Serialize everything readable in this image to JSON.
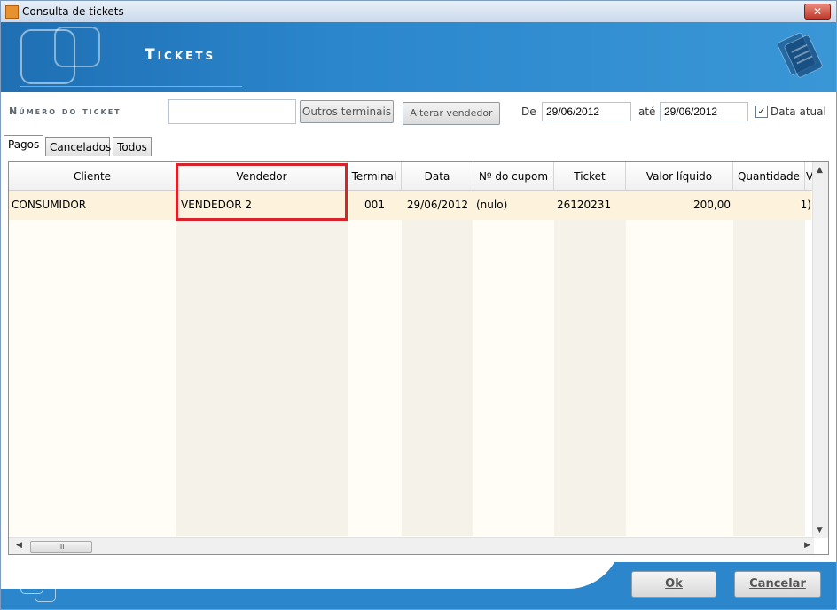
{
  "window": {
    "title": "Consulta de tickets",
    "close_label": "✕"
  },
  "header": {
    "title": "Tickets"
  },
  "filters": {
    "ticket_label": "Número do ticket",
    "ticket_value": "",
    "other_terminals_label": "Outros terminais",
    "change_seller_label": "Alterar vendedor",
    "from_label": "De",
    "from_value": "29/06/2012",
    "to_label": "até",
    "to_value": "29/06/2012",
    "current_date_label": "Data atual",
    "current_date_checked": true
  },
  "tabs": [
    {
      "label": "Pagos",
      "active": true
    },
    {
      "label": "Cancelados",
      "active": false
    },
    {
      "label": "Todos",
      "active": false
    }
  ],
  "grid": {
    "columns": [
      "Cliente",
      "Vendedor",
      "Terminal",
      "Data",
      "Nº do cupom",
      "Ticket",
      "Valor líquido",
      "Quantidade",
      "V"
    ],
    "rows": [
      [
        "CONSUMIDOR",
        "VENDEDOR 2",
        "001",
        "29/06/2012",
        "(nulo)",
        "26120231",
        "200,00",
        "1)"
      ]
    ],
    "hscroll_thumb": "III"
  },
  "footer": {
    "ok_label": "Ok",
    "cancel_label": "Cancelar"
  }
}
